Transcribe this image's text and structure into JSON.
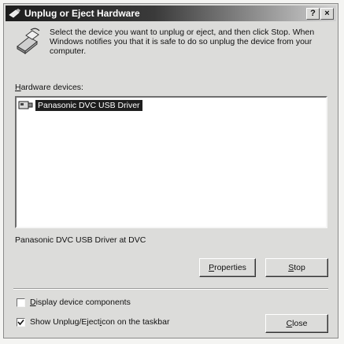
{
  "window": {
    "title": "Unplug or Eject Hardware",
    "help_label": "?",
    "close_label": "×"
  },
  "description": "Select the device you want to unplug or eject, and then click Stop. When Windows notifies you that it is safe to do so unplug the device from your computer.",
  "hardware_label_prefix": "",
  "hardware_label_accel": "H",
  "hardware_label_rest": "ardware devices:",
  "devices": [
    {
      "name": "Panasonic DVC USB Driver",
      "selected": true,
      "icon": "usb-device-icon"
    }
  ],
  "status_text": "Panasonic DVC USB Driver at DVC",
  "buttons": {
    "properties": {
      "accel": "P",
      "rest": "roperties"
    },
    "stop": {
      "accel": "S",
      "rest": "top"
    },
    "close": {
      "accel": "C",
      "rest": "lose"
    }
  },
  "options": {
    "display_components": {
      "accel": "D",
      "rest": "isplay device components",
      "checked": false
    },
    "show_icon": {
      "before": "Show Unplug/Eject ",
      "accel": "i",
      "rest": "con on the taskbar",
      "checked": true
    }
  }
}
